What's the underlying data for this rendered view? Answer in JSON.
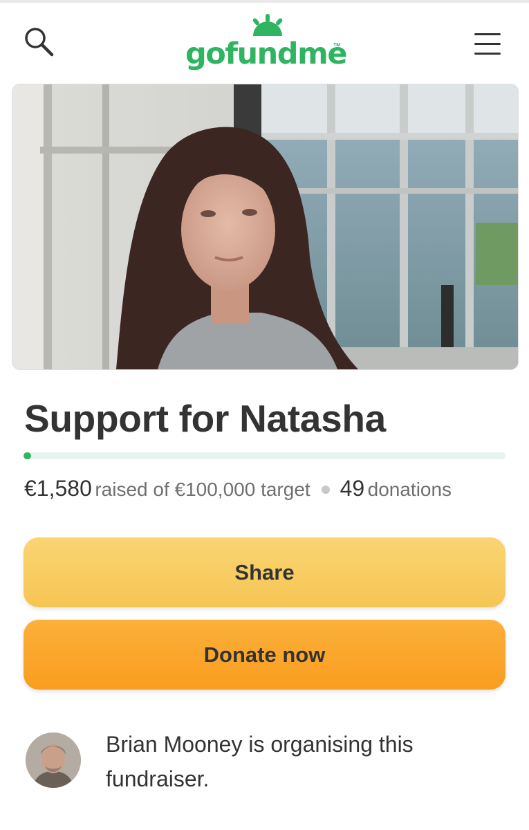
{
  "header": {
    "logo_text": "gofundme",
    "logo_tm": "TM",
    "search_icon": "search-icon",
    "menu_icon": "menu-icon",
    "brand_color": "#2fb462"
  },
  "campaign": {
    "title": "Support for Natasha",
    "raised": "€1,580",
    "raised_text": "raised of €100,000 target",
    "donations_count": "49",
    "donations_label": "donations",
    "progress_fraction": 0.0158
  },
  "actions": {
    "share_label": "Share",
    "donate_label": "Donate now"
  },
  "organiser": {
    "text": "Brian Mooney is organising this fundraiser."
  }
}
